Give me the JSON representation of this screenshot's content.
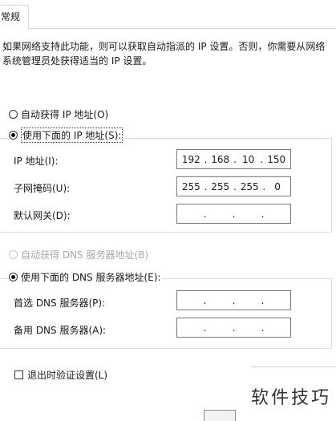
{
  "tab": {
    "label": "常规"
  },
  "description": "如果网络支持此功能，则可以获取自动指派的 IP 设置。否则，你需要从网络系统管理员处获得适当的 IP 设置。",
  "ip_section": {
    "auto_radio": "自动获得 IP 地址(O)",
    "manual_radio": "使用下面的 IP 地址(S):",
    "selected": "manual",
    "fields": {
      "ip_label": "IP 地址(I):",
      "ip_value": [
        "192",
        "168",
        "10",
        "150"
      ],
      "mask_label": "子网掩码(U):",
      "mask_value": [
        "255",
        "255",
        "255",
        "0"
      ],
      "gateway_label": "默认网关(D):",
      "gateway_value": [
        "",
        "",
        "",
        ""
      ]
    }
  },
  "dns_section": {
    "auto_radio": "自动获得 DNS 服务器地址(B)",
    "manual_radio": "使用下面的 DNS 服务器地址(E):",
    "selected": "manual",
    "fields": {
      "preferred_label": "首选 DNS 服务器(P):",
      "preferred_value": [
        "",
        "",
        "",
        ""
      ],
      "alternate_label": "备用 DNS 服务器(A):",
      "alternate_value": [
        "",
        "",
        "",
        ""
      ]
    }
  },
  "validate_checkbox": {
    "label": "退出时验证设置(L)",
    "checked": false
  },
  "watermark": "软件技巧"
}
